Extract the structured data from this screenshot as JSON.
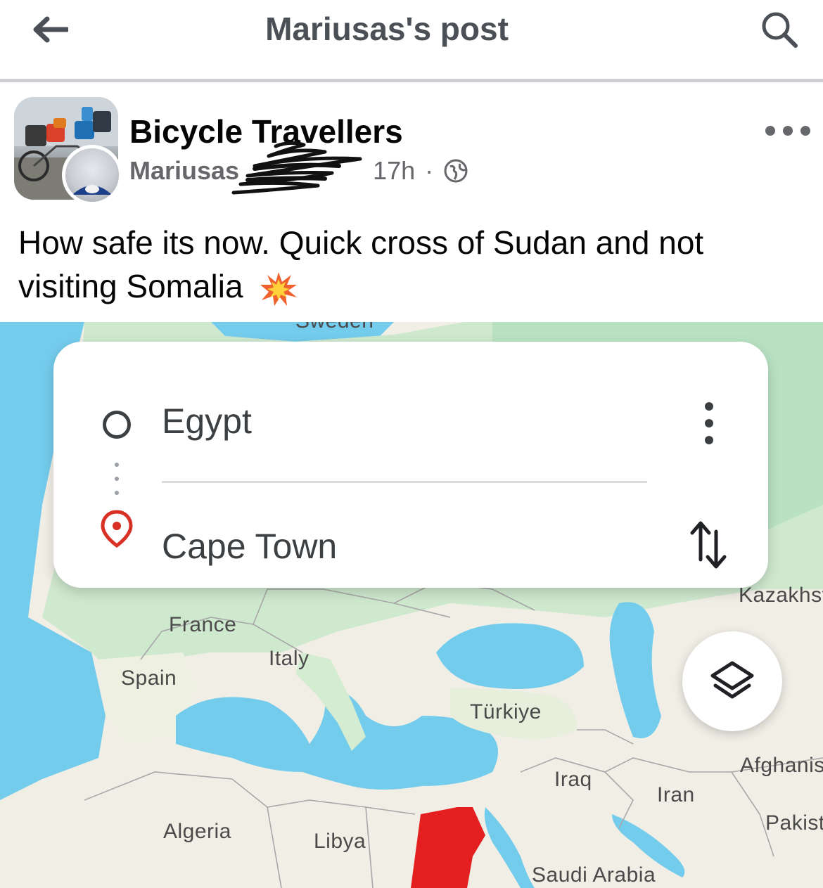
{
  "header": {
    "title": "Mariusas's post"
  },
  "post": {
    "group_name": "Bicycle Travellers",
    "author": "Mariusas",
    "time": "17h",
    "separator": "·",
    "text": "How safe its now. Quick cross of Sudan and not visiting Somalia"
  },
  "map": {
    "origin": "Egypt",
    "destination": "Cape Town",
    "labels": {
      "sweden": "Sweden",
      "france": "France",
      "italy": "Italy",
      "spain": "Spain",
      "turkiye": "Türkiye",
      "kazakhstan": "Kazakhst",
      "iraq": "Iraq",
      "iran": "Iran",
      "afghanistan": "Afghanis",
      "pakistan": "Pakist",
      "algeria": "Algeria",
      "libya": "Libya",
      "saudi_arabia": "Saudi Arabia"
    },
    "colors": {
      "water": "#74ccec",
      "land": "#f1eee6",
      "green": "#b9e2c3",
      "highlight": "#e31f1f"
    }
  },
  "icons": {
    "back": "arrow-left-icon",
    "search": "search-icon",
    "globe": "globe-icon",
    "more": "more-dots-icon",
    "emoji": "collision-emoji-icon",
    "origin": "circle-outline-icon",
    "destination": "location-pin-icon",
    "swap": "swap-arrows-icon",
    "layers": "layers-icon"
  }
}
